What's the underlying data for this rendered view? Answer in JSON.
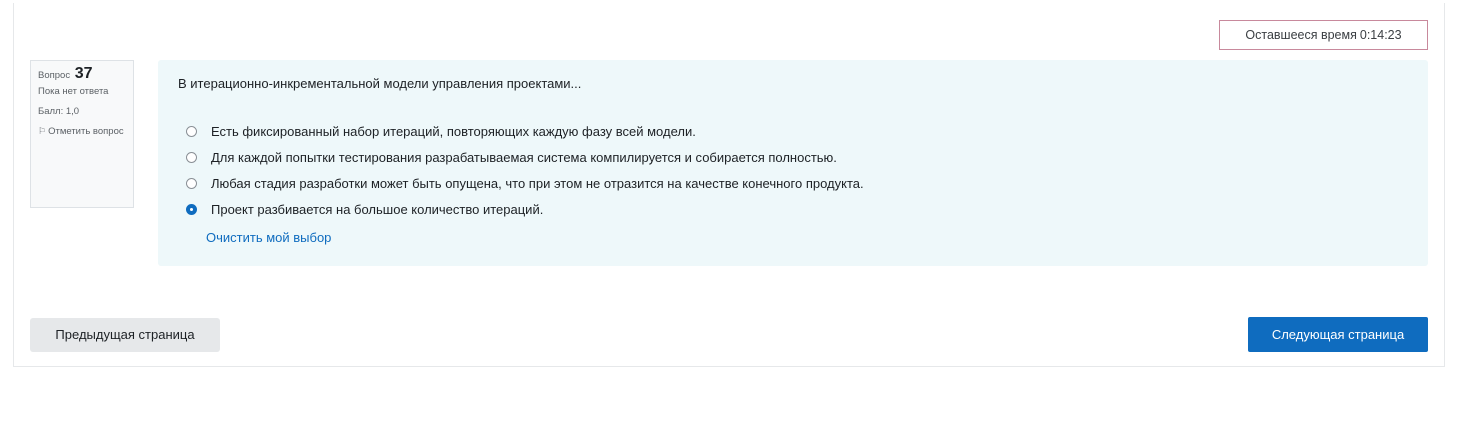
{
  "timer": {
    "label": "Оставшееся время",
    "value": "0:14:23"
  },
  "question_info": {
    "label": "Вопрос",
    "number": "37",
    "state": "Пока нет ответа",
    "grade": "Балл: 1,0",
    "flag_label": "Отметить вопрос",
    "flag_icon": "flag-icon"
  },
  "question": {
    "text": "В итерационно-инкрементальной модели управления проектами...",
    "answers": [
      {
        "label": "Есть фиксированный набор итераций, повторяющих каждую фазу всей модели.",
        "selected": false
      },
      {
        "label": "Для каждой попытки тестирования разрабатываемая система компилируется и собирается полностью.",
        "selected": false
      },
      {
        "label": "Любая стадия разработки может быть опущена, что при этом не отразится на качестве конечного продукта.",
        "selected": false
      },
      {
        "label": "Проект разбивается на большое количество итераций.",
        "selected": true
      }
    ],
    "clear_label": "Очистить мой выбор"
  },
  "navigation": {
    "prev_label": "Предыдущая страница",
    "next_label": "Следующая страница"
  },
  "colors": {
    "accent": "#0f6cbf",
    "question_bg": "#eef8fa",
    "timer_border": "#c8899c"
  }
}
